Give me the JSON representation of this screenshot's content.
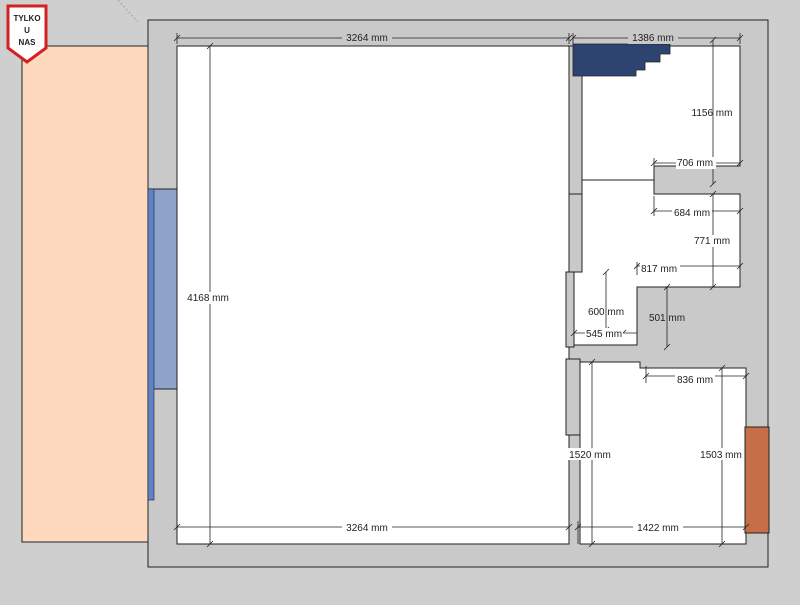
{
  "logo": {
    "line1": "TYLKO",
    "line2": "U",
    "line3": "NAS"
  },
  "colors": {
    "background": "#cfcfcf",
    "walls": "#c9c9c9",
    "room_fill": "#ffffff",
    "terrace": "#ffd9bd",
    "window_blue": "#7f97c2",
    "stairs": "#2e4470",
    "door_orange": "#c46f47"
  },
  "dimensions": {
    "top_main": "3264 mm",
    "top_right": "1386 mm",
    "right_upper": "1156 mm",
    "notch_width": "706 mm",
    "corridor_width": "684 mm",
    "corridor_height": "771 mm",
    "small_room_width": "817 mm",
    "closet_height": "600 mm",
    "closet_width": "545 mm",
    "small_room_height": "501 mm",
    "bathroom_width": "836 mm",
    "left_height": "4168 mm",
    "bathroom_left_height": "1520 mm",
    "bathroom_right_height": "1503 mm",
    "bottom_main": "3264 mm",
    "bottom_right": "1422 mm"
  }
}
